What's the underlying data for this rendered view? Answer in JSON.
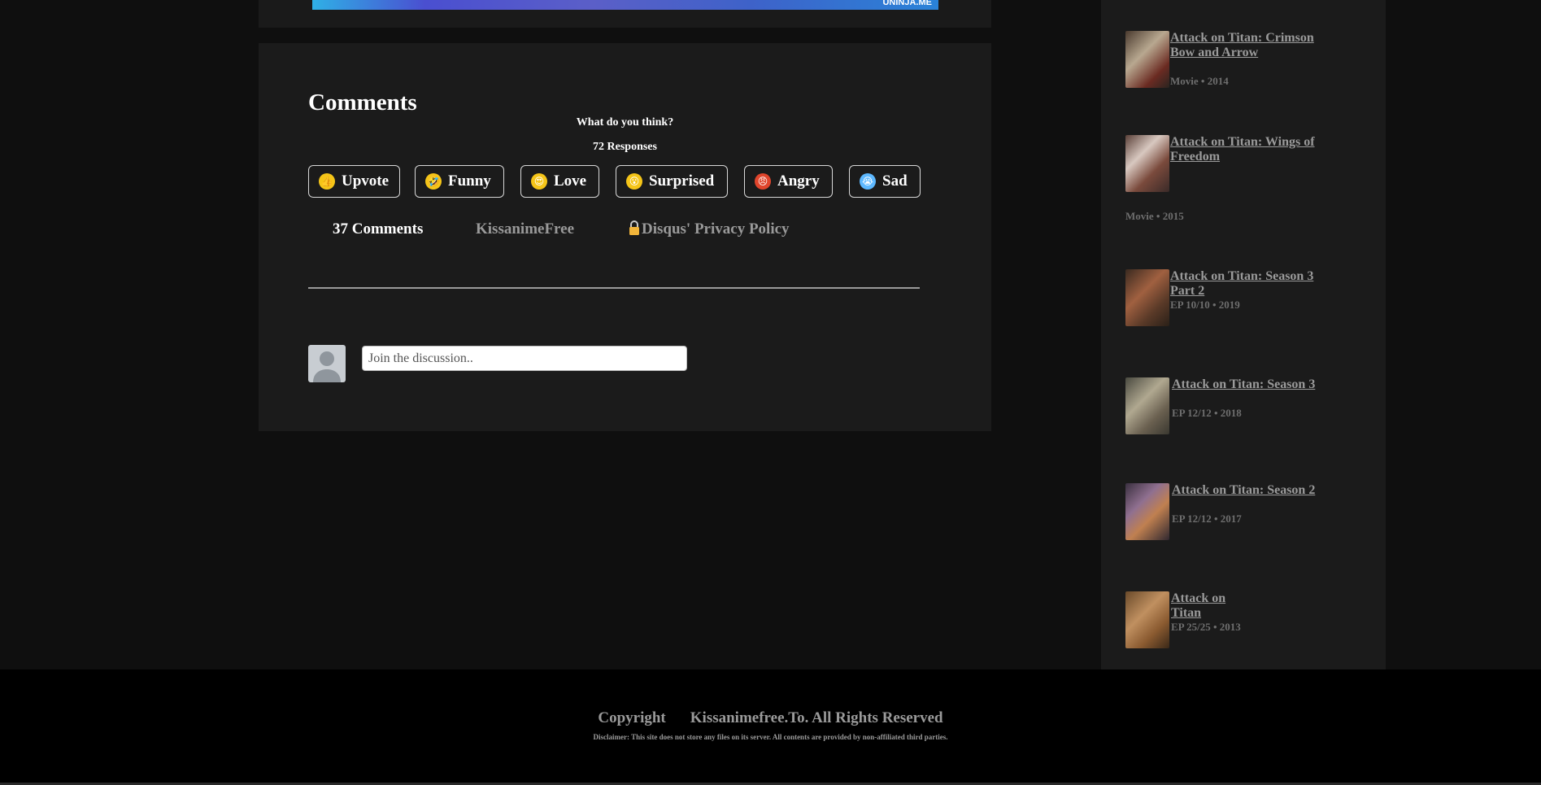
{
  "banner": {
    "text": "UNINJA.ME"
  },
  "comments": {
    "title": "Comments",
    "question": "What do you think?",
    "responses": "72 Responses",
    "reactions": [
      {
        "label": "Upvote",
        "icon": "thumbs-up-icon",
        "color": "#f5c518",
        "glyph": "👍"
      },
      {
        "label": "Funny",
        "icon": "laughing-face-icon",
        "color": "#f5c518",
        "glyph": "🤣"
      },
      {
        "label": "Love",
        "icon": "heart-eyes-face-icon",
        "color": "#f5c518",
        "glyph": "😍"
      },
      {
        "label": "Surprised",
        "icon": "surprised-face-icon",
        "color": "#f5c518",
        "glyph": "😮"
      },
      {
        "label": "Angry",
        "icon": "angry-face-icon",
        "color": "#e0452c",
        "glyph": "😠"
      },
      {
        "label": "Sad",
        "icon": "crying-face-icon",
        "color": "#5db8ff",
        "glyph": "😭"
      }
    ],
    "tabs": {
      "count": "37 Comments",
      "community": "KissanimeFree",
      "privacy": "Disqus' Privacy Policy"
    },
    "input_placeholder": "Join the discussion.."
  },
  "sidebar": {
    "items": [
      {
        "title": "Attack on Titan: Crimson Bow and Arrow",
        "meta": "Movie • 2014"
      },
      {
        "title": "Attack on Titan: Wings of Freedom",
        "meta": "Movie • 2015"
      },
      {
        "title": "Attack on Titan: Season 3 Part 2",
        "meta": "EP 10/10 • 2019"
      },
      {
        "title": "Attack on Titan: Season 3",
        "meta": "EP 12/12 • 2018"
      },
      {
        "title": "Attack on Titan: Season 2",
        "meta": "EP 12/12 • 2017"
      },
      {
        "title": "Attack on Titan",
        "meta": "EP 25/25 • 2013"
      }
    ]
  },
  "footer": {
    "copyright": "Copyright",
    "rights": "Kissanimefree.To. All Rights Reserved",
    "disclaimer": "Disclaimer: This site does not store any files on its server. All contents are provided by non-affiliated third parties."
  }
}
